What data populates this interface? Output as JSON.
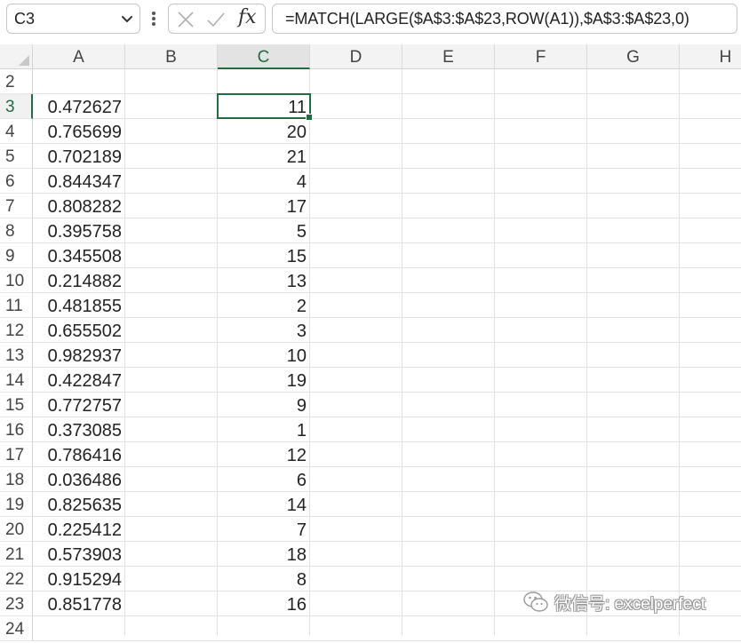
{
  "formula_bar": {
    "name_box": "C3",
    "formula": "=MATCH(LARGE($A$3:$A$23,ROW(A1)),$A$3:$A$23,0)",
    "fx_label": "fx"
  },
  "columns": [
    "A",
    "B",
    "C",
    "D",
    "E",
    "F",
    "G",
    "H"
  ],
  "active_column": "C",
  "active_row": "3",
  "row_numbers": [
    "2",
    "3",
    "4",
    "5",
    "6",
    "7",
    "8",
    "9",
    "10",
    "11",
    "12",
    "13",
    "14",
    "15",
    "16",
    "17",
    "18",
    "19",
    "20",
    "21",
    "22",
    "23",
    "24"
  ],
  "column_a_values": [
    "0.472627",
    "0.765699",
    "0.702189",
    "0.844347",
    "0.808282",
    "0.395758",
    "0.345508",
    "0.214882",
    "0.481855",
    "0.655502",
    "0.982937",
    "0.422847",
    "0.772757",
    "0.373085",
    "0.786416",
    "0.036486",
    "0.825635",
    "0.225412",
    "0.573903",
    "0.915294",
    "0.851778"
  ],
  "column_c_values": [
    "11",
    "20",
    "21",
    "4",
    "17",
    "5",
    "15",
    "13",
    "2",
    "3",
    "10",
    "19",
    "9",
    "1",
    "12",
    "6",
    "14",
    "7",
    "18",
    "8",
    "16"
  ],
  "watermark": "微信号: excelperfect",
  "colors": {
    "accent": "#1e6e42",
    "header_bg": "#f3f3f3",
    "gridline": "#e1e1e1"
  }
}
